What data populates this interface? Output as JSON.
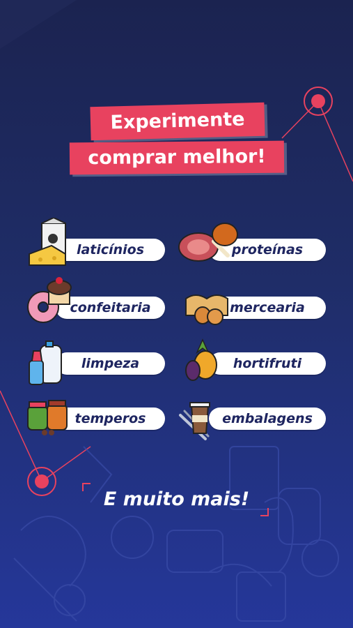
{
  "headline": {
    "line1": "Experimente",
    "line2": "comprar melhor!"
  },
  "categories": [
    {
      "label": "laticínios",
      "icon": "dairy-icon"
    },
    {
      "label": "proteínas",
      "icon": "meat-icon"
    },
    {
      "label": "confeitaria",
      "icon": "donut-cupcake-icon"
    },
    {
      "label": "mercearia",
      "icon": "bread-eggs-icon"
    },
    {
      "label": "limpeza",
      "icon": "cleaning-bottles-icon"
    },
    {
      "label": "hortifruti",
      "icon": "pineapple-eggplant-icon"
    },
    {
      "label": "temperos",
      "icon": "spice-jars-icon"
    },
    {
      "label": "embalagens",
      "icon": "coffee-cup-cutlery-icon"
    }
  ],
  "footer": {
    "text": "E muito mais!"
  },
  "colors": {
    "accent": "#e8425f",
    "background": "#1f2d68",
    "pill": "#ffffff",
    "pill_text": "#1e2560"
  }
}
